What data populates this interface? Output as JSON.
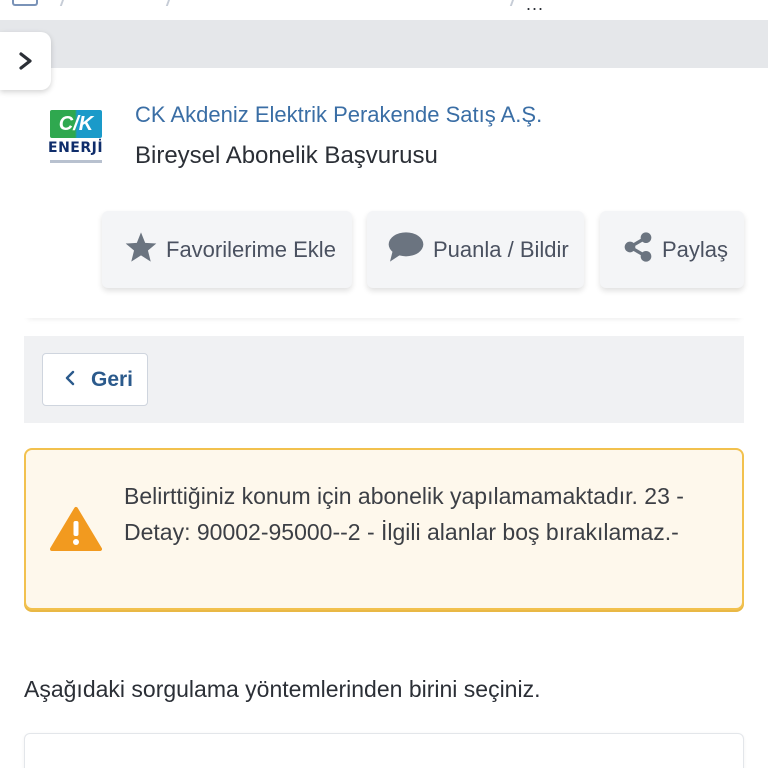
{
  "breadcrumb": {
    "trailing": "..."
  },
  "header": {
    "logo_text_top": "C/K",
    "logo_text_bottom": "ENERJİ",
    "company": "CK Akdeniz Elektrik Perakende Satış A.Ş.",
    "service_title": "Bireysel Abonelik Başvurusu"
  },
  "actions": {
    "favorite": {
      "label": "Favorilerime Ekle",
      "icon": "star-icon"
    },
    "rate": {
      "label": "Puanla / Bildir",
      "icon": "speech-bubble-icon"
    },
    "share": {
      "label": "Paylaş",
      "icon": "share-icon"
    }
  },
  "nav": {
    "back_label": "Geri"
  },
  "alert": {
    "icon": "warning-triangle-icon",
    "message": "Belirttiğiniz konum için abonelik yapılamamaktadır. 23 - Detay: 90002-95000--2 - İlgili alanlar boş bırakılamaz.-"
  },
  "main": {
    "prompt": "Aşağıdaki sorgulama yöntemlerinden birini seçiniz."
  },
  "colors": {
    "link_blue": "#3a6ea5",
    "warning_orange": "#f29a1f",
    "alert_border": "#f2c14e",
    "alert_bg": "#fef8ec",
    "button_text": "#4a5160"
  }
}
